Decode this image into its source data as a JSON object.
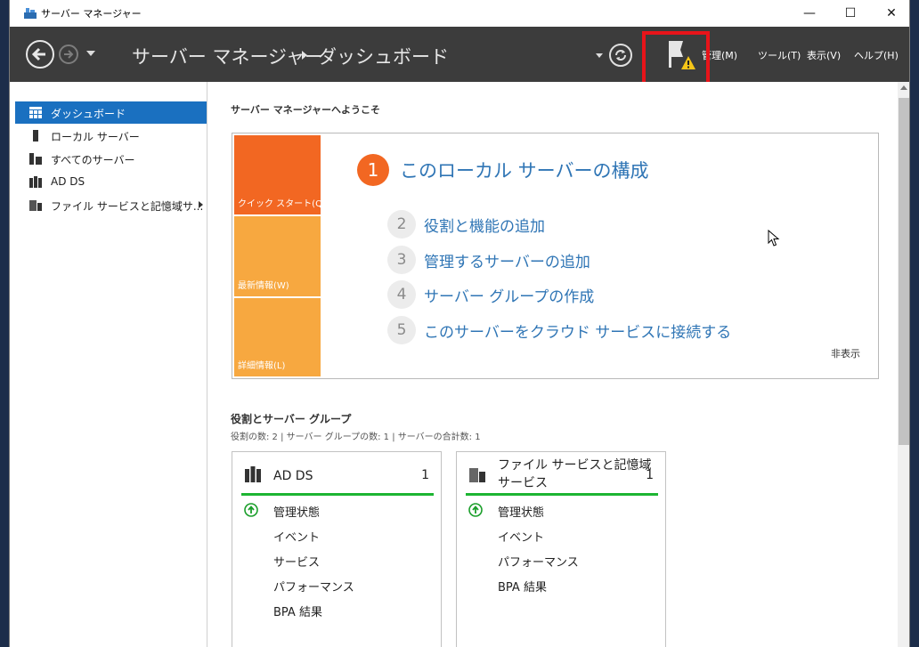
{
  "window": {
    "title": "サーバー マネージャー",
    "minimize_glyph": "—",
    "maximize_glyph": "☐",
    "close_glyph": "✕"
  },
  "header": {
    "breadcrumb_root": "サーバー マネージャー",
    "breadcrumb_page": "ダッシュボード",
    "menu": [
      {
        "label": "管理(M)"
      },
      {
        "label": "ツール(T)"
      },
      {
        "label": "表示(V)"
      },
      {
        "label": "ヘルプ(H)"
      }
    ],
    "icons": {
      "back": "back-arrow-icon",
      "forward": "forward-arrow-icon",
      "refresh": "refresh-icon",
      "notifications": "notification-flag-warning-icon"
    }
  },
  "sidebar": {
    "items": [
      {
        "label": "ダッシュボード",
        "icon": "dashboard-icon",
        "active": true
      },
      {
        "label": "ローカル サーバー",
        "icon": "server-icon"
      },
      {
        "label": "すべてのサーバー",
        "icon": "servers-icon"
      },
      {
        "label": "AD DS",
        "icon": "ad-ds-icon"
      },
      {
        "label": "ファイル サービスと記憶域サ...",
        "icon": "file-services-icon",
        "has_submenu": true
      }
    ]
  },
  "main": {
    "welcome": "サーバー マネージャーへようこそ",
    "quick_start": {
      "tabs": [
        {
          "label": "クイック スタート(Q)",
          "color": "#f26722"
        },
        {
          "label": "最新情報(W)",
          "color": "#f7a840"
        },
        {
          "label": "詳細情報(L)",
          "color": "#f7a840"
        }
      ],
      "main_step": {
        "number": "1",
        "label": "このローカル サーバーの構成"
      },
      "steps": [
        {
          "number": "2",
          "label": "役割と機能の追加"
        },
        {
          "number": "3",
          "label": "管理するサーバーの追加"
        },
        {
          "number": "4",
          "label": "サーバー グループの作成"
        },
        {
          "number": "5",
          "label": "このサーバーをクラウド サービスに接続する"
        }
      ],
      "hide_label": "非表示"
    },
    "roles": {
      "title": "役割とサーバー グループ",
      "summary": "役割の数: 2 | サーバー グループの数: 1 | サーバーの合計数: 1",
      "tiles": [
        {
          "name": "AD DS",
          "count": "1",
          "rows": [
            "管理状態",
            "イベント",
            "サービス",
            "パフォーマンス",
            "BPA 結果"
          ]
        },
        {
          "name": "ファイル サービスと記憶域\nサービス",
          "count": "1",
          "rows": [
            "管理状態",
            "イベント",
            "パフォーマンス",
            "BPA 結果"
          ]
        }
      ]
    }
  },
  "colors": {
    "header_bg": "#3c3c3c",
    "accent_blue": "#1a70c0",
    "link_blue": "#2f75b5",
    "quick_start_orange": "#f26722",
    "tab_amber": "#f7a840",
    "status_green": "#1db532",
    "highlight_red": "#e8141a"
  }
}
